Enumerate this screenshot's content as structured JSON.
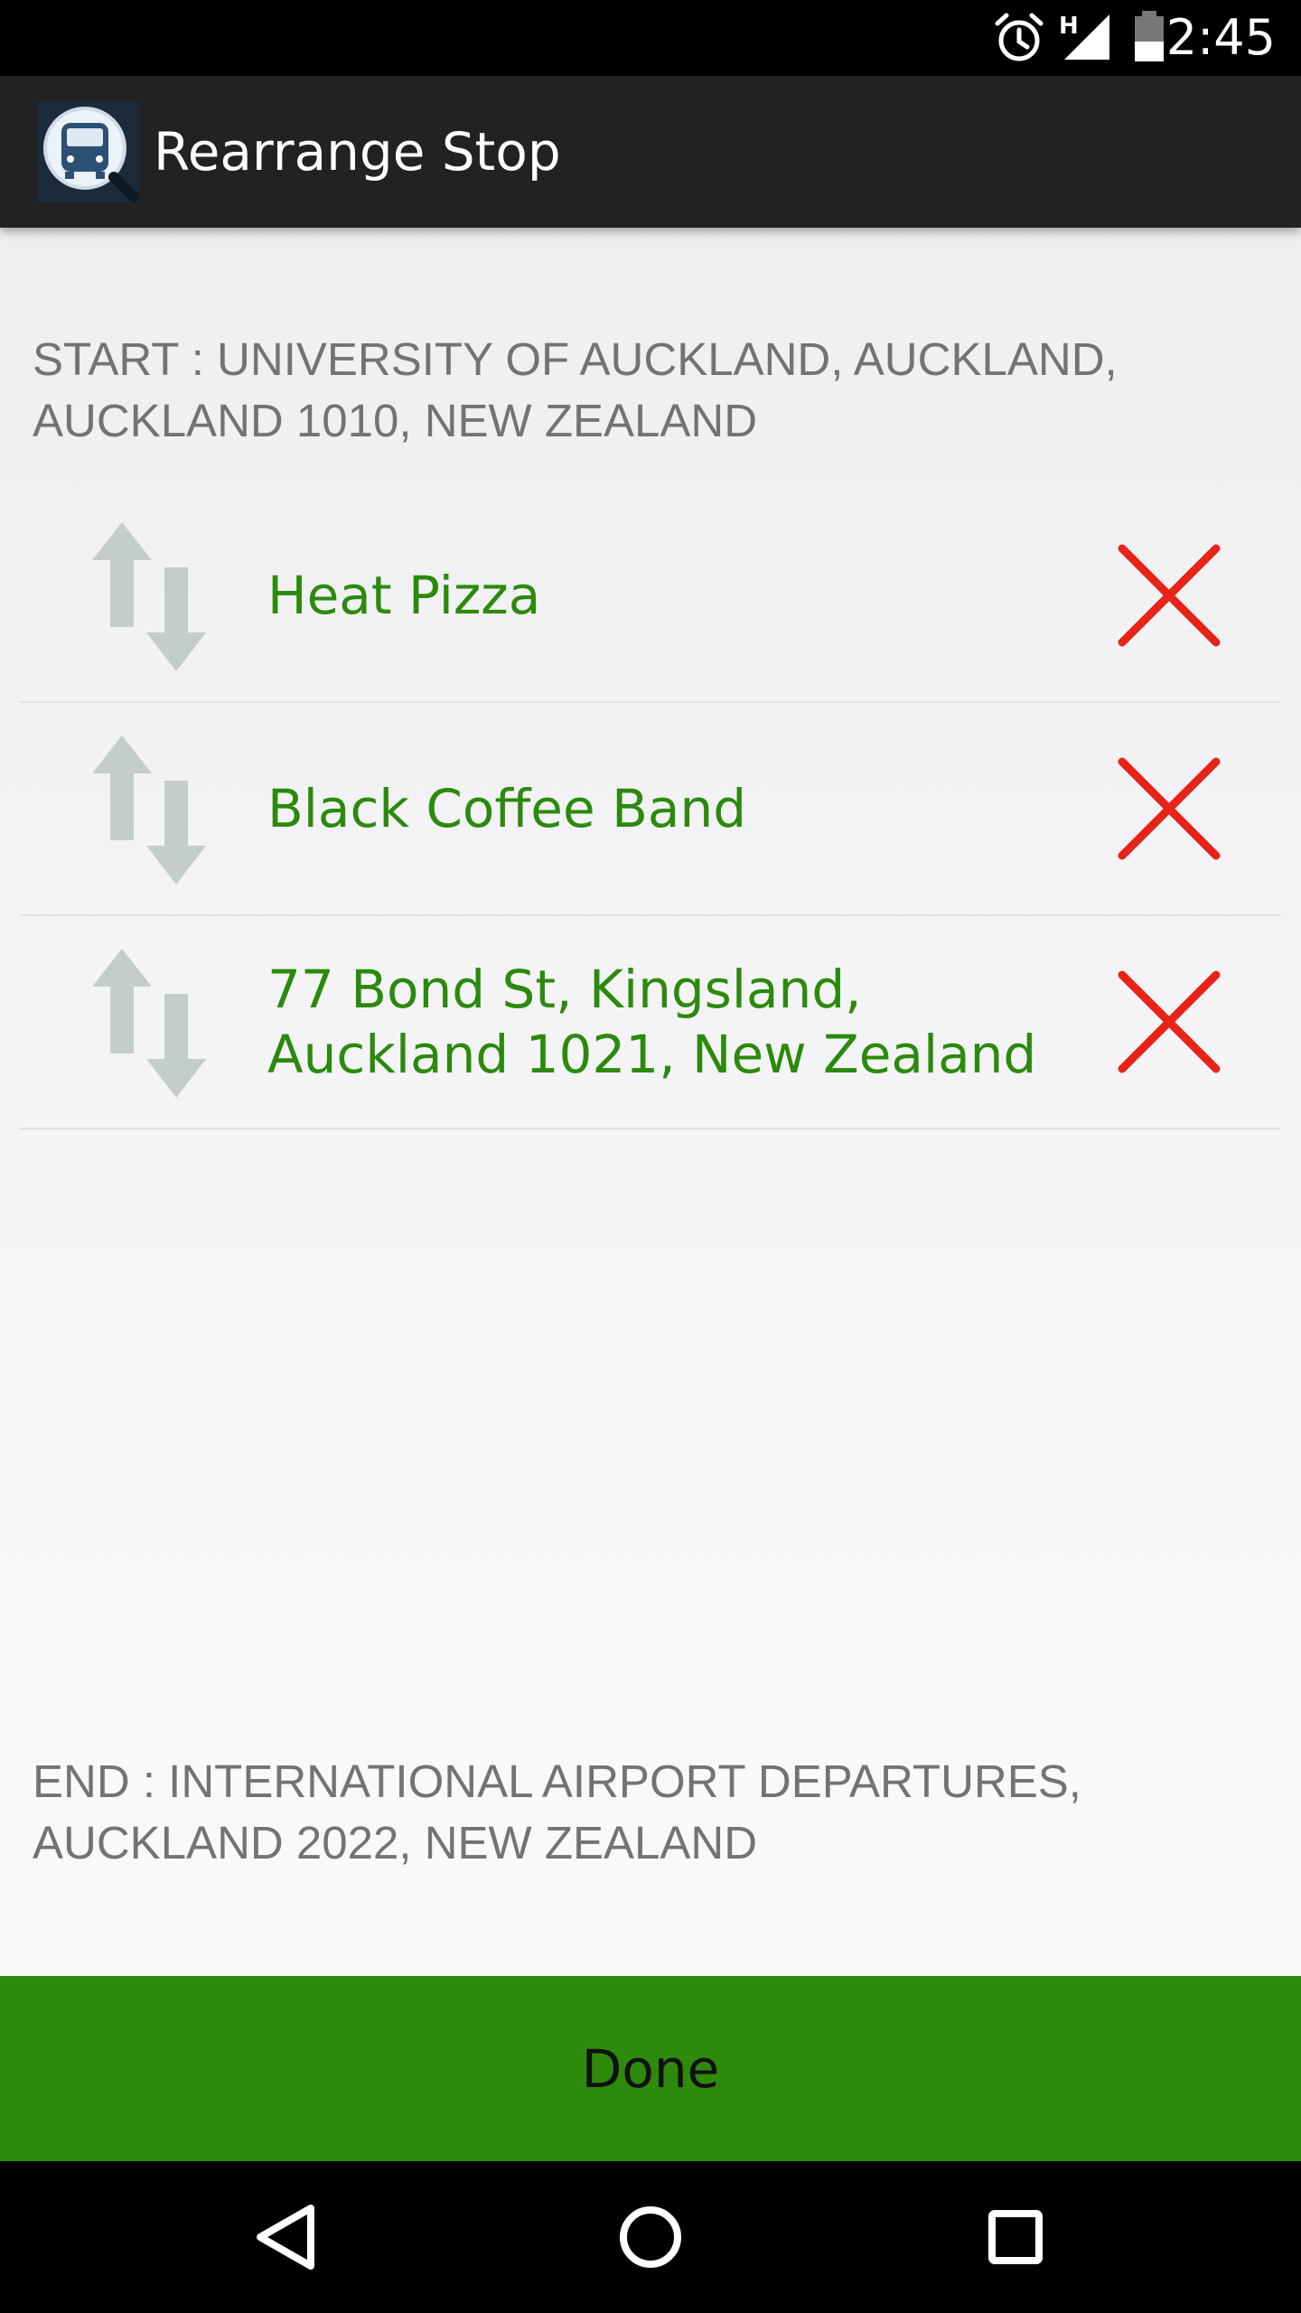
{
  "status_bar": {
    "time": "2:45",
    "network_label": "H",
    "icons": [
      "alarm-icon",
      "signal-icon",
      "battery-icon"
    ]
  },
  "action_bar": {
    "title": "Rearrange Stop",
    "app_icon": "bus-search-icon"
  },
  "route": {
    "start": "START : UNIVERSITY OF AUCKLAND, AUCKLAND, AUCKLAND 1010, NEW ZEALAND",
    "end": "END : INTERNATIONAL AIRPORT DEPARTURES, AUCKLAND 2022, NEW ZEALAND"
  },
  "stops": [
    {
      "name": "Heat Pizza"
    },
    {
      "name": "Black Coffee Band"
    },
    {
      "name": "77 Bond St, Kingsland, Auckland 1021, New Zealand"
    }
  ],
  "done_button": {
    "label": "Done"
  },
  "colors": {
    "accent_green": "#2d8a0a",
    "stop_text_green": "#2b8a0c",
    "remove_red": "#e8231a",
    "action_bar": "#222224"
  },
  "nav_bar": {
    "icons": [
      "back-icon",
      "home-icon",
      "recents-icon"
    ]
  }
}
